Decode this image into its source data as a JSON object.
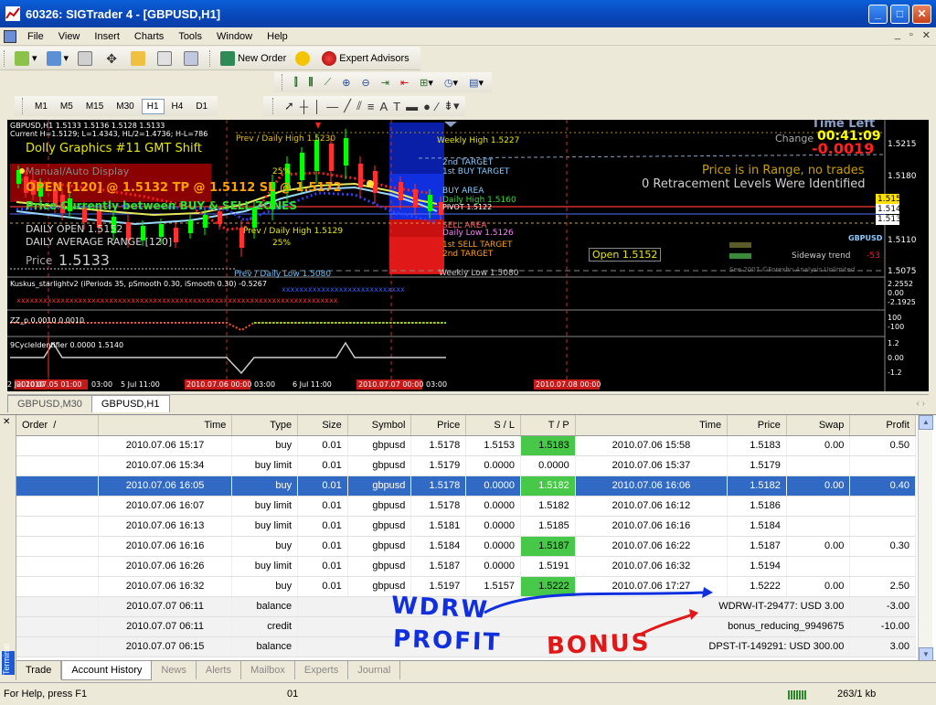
{
  "window": {
    "title": "60326: SIGTrader 4 - [GBPUSD,H1]"
  },
  "menu": [
    "File",
    "View",
    "Insert",
    "Charts",
    "Tools",
    "Window",
    "Help"
  ],
  "toolbar1": {
    "new_order": "New Order",
    "expert_advisors": "Expert Advisors"
  },
  "timeframes": [
    "M1",
    "M5",
    "M15",
    "M30",
    "H1",
    "H4",
    "D1"
  ],
  "active_timeframe": "H1",
  "chart": {
    "header1": "GBPUSD,H1  1.5133 1.5136 1.5128 1.5133",
    "header2": "Current H=1.5129; L=1.4343, HL/2=1.4736; H-L=786",
    "dolly": "Dolly Graphics #11 GMT Shift",
    "auto": "Manual/Auto Display",
    "open_trade": "OPEN  [120] @ 1.5132   TP @ 1.5112   SL @ 1.5172",
    "price_between": "Price Currently between BUY & SELL ZONES",
    "daily_open": "DAILY OPEN  1.5152",
    "daily_avg": "DAILY AVERAGE RANGE  [120]",
    "price_label": "Price",
    "price_value": "1.5133",
    "prev_daily_high": "Prev / Daily High 1.5230",
    "weekly_high": "Weekly High 1.5227",
    "target2_buy": "2nd TARGET",
    "target1_buy": "1st BUY TARGET",
    "buy_area": "BUY AREA",
    "daily_high": "Daily High 1.5160",
    "pivot": "PIVOT 1.5122",
    "sell_area": "SELL AREA",
    "daily_low": "Daily Low 1.5126",
    "target1_sell": "1st SELL TARGET",
    "target2_sell": "2nd TARGET",
    "weekly_low": "Weekly Low 1.5080",
    "prev_daily_high2": "Prev / Daily High 1.5129",
    "prev_daily_low": "Prev / Daily Low 1.5080",
    "pct25a": "25%",
    "pct25b": "25%",
    "time_left": "Time Left",
    "change_label": "Change",
    "time_value": "00:41:09",
    "change_value": "-0.0019",
    "range_msg": "Price is in Range, no trades",
    "retrace_msg": "0 Retracement Levels Were Identified",
    "open_box": "Open 1.5152",
    "sym": "GBPUSD",
    "sideway": "Sideway trend",
    "sideway_val": "-53",
    "copyright": "See 2007 ©Forexhn Analysis Unlimited",
    "price_axis": [
      "1.5215",
      "1.5180",
      "1.5152",
      "1.5145",
      "1.5133",
      "1.5110",
      "1.5075"
    ],
    "ind1": "Kuskus_starlightv2 (iPeriods 35, pSmooth 0.30, iSmooth 0.30)  -0.5267",
    "ind1_axis": [
      "2.2552",
      "0.00",
      "-2.1925"
    ],
    "ind2": "ZZ_p 0.0010 0.0010",
    "ind2_axis": [
      "100",
      "-100"
    ],
    "ind3": "9CycleIdentifier 0.0000 1.5140",
    "ind3_axis": [
      "1.2",
      "0.00",
      "-1.2"
    ],
    "time_axis": [
      "2 Jul 2010",
      "2010.07.05 01:00",
      "03:00",
      "5 Jul 11:00",
      "2010.07.06 00:00",
      "03:00",
      "6 Jul 11:00",
      "2010.07.07 00:00",
      "03:00",
      "2010.07.08 00:00"
    ]
  },
  "chart_tabs": [
    "GBPUSD,M30",
    "GBPUSD,H1"
  ],
  "terminal": {
    "columns": [
      "Order",
      "Time",
      "Type",
      "Size",
      "Symbol",
      "Price",
      "S / L",
      "T / P",
      "Time",
      "Price",
      "Swap",
      "Profit"
    ],
    "rows": [
      {
        "t1": "2010.07.06 15:17",
        "type": "buy",
        "size": "0.01",
        "sym": "gbpusd",
        "p1": "1.5178",
        "sl": "1.5153",
        "tp": "1.5183",
        "t2": "2010.07.06 15:58",
        "p2": "1.5183",
        "swap": "0.00",
        "profit": "0.50",
        "tp_green": true
      },
      {
        "t1": "2010.07.06 15:34",
        "type": "buy limit",
        "size": "0.01",
        "sym": "gbpusd",
        "p1": "1.5179",
        "sl": "0.0000",
        "tp": "0.0000",
        "t2": "2010.07.06 15:37",
        "p2": "1.5179",
        "swap": "",
        "profit": ""
      },
      {
        "t1": "2010.07.06 16:05",
        "type": "buy",
        "size": "0.01",
        "sym": "gbpusd",
        "p1": "1.5178",
        "sl": "0.0000",
        "tp": "1.5182",
        "t2": "2010.07.06 16:06",
        "p2": "1.5182",
        "swap": "0.00",
        "profit": "0.40",
        "tp_green": true,
        "selected": true
      },
      {
        "t1": "2010.07.06 16:07",
        "type": "buy limit",
        "size": "0.01",
        "sym": "gbpusd",
        "p1": "1.5178",
        "sl": "0.0000",
        "tp": "1.5182",
        "t2": "2010.07.06 16:12",
        "p2": "1.5186",
        "swap": "",
        "profit": ""
      },
      {
        "t1": "2010.07.06 16:13",
        "type": "buy limit",
        "size": "0.01",
        "sym": "gbpusd",
        "p1": "1.5181",
        "sl": "0.0000",
        "tp": "1.5185",
        "t2": "2010.07.06 16:16",
        "p2": "1.5184",
        "swap": "",
        "profit": ""
      },
      {
        "t1": "2010.07.06 16:16",
        "type": "buy",
        "size": "0.01",
        "sym": "gbpusd",
        "p1": "1.5184",
        "sl": "0.0000",
        "tp": "1.5187",
        "t2": "2010.07.06 16:22",
        "p2": "1.5187",
        "swap": "0.00",
        "profit": "0.30",
        "tp_green": true
      },
      {
        "t1": "2010.07.06 16:26",
        "type": "buy limit",
        "size": "0.01",
        "sym": "gbpusd",
        "p1": "1.5187",
        "sl": "0.0000",
        "tp": "1.5191",
        "t2": "2010.07.06 16:32",
        "p2": "1.5194",
        "swap": "",
        "profit": ""
      },
      {
        "t1": "2010.07.06 16:32",
        "type": "buy",
        "size": "0.01",
        "sym": "gbpusd",
        "p1": "1.5197",
        "sl": "1.5157",
        "tp": "1.5222",
        "t2": "2010.07.06 17:27",
        "p2": "1.5222",
        "swap": "0.00",
        "profit": "2.50",
        "tp_green": true
      }
    ],
    "balance_rows": [
      {
        "t1": "2010.07.07 06:11",
        "type": "balance",
        "comment": "WDRW-IT-29477: USD 3.00",
        "profit": "-3.00"
      },
      {
        "t1": "2010.07.07 06:11",
        "type": "credit",
        "comment": "bonus_reducing_9949675",
        "profit": "-10.00"
      },
      {
        "t1": "2010.07.07 06:15",
        "type": "balance",
        "comment": "DPST-IT-149291: USD 300.00",
        "profit": "3.00"
      }
    ]
  },
  "annotations": {
    "wdrw": "WDRW",
    "profit": "PROFIT",
    "bonus": "BONUS"
  },
  "bottom_tabs": [
    "Trade",
    "Account History",
    "News",
    "Alerts",
    "Mailbox",
    "Experts",
    "Journal"
  ],
  "active_bottom_tab": "Account History",
  "terminal_label": "Terminal",
  "status": {
    "help": "For Help, press F1",
    "profile": "01",
    "traffic": "263/1 kb"
  }
}
